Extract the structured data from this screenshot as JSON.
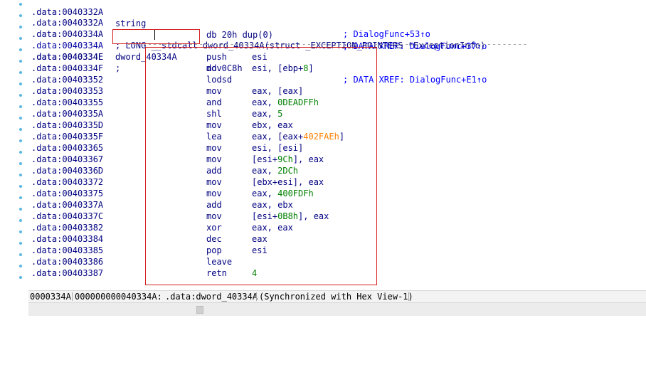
{
  "colors": {
    "address": "#000080",
    "comment": "#0000ff",
    "number": "#008000",
    "hex_constant": "#ff8000",
    "highlight_box": "#d42020",
    "gutter_dot": "#59b7e6"
  },
  "top_lines": [
    {
      "addr": ".data:0040332A",
      "text": "string",
      "text2": "db 20h dup(0)",
      "comment": "; DATA XREF: DialogFunc+37↑o"
    },
    {
      "addr": ".data:0040332A",
      "text": "",
      "text2": "",
      "comment": "; DialogFunc+53↑o"
    },
    {
      "addr": ".data:0040334A",
      "text": "; LONG __stdcall dword_40334A(struct _EXCEPTION_POINTERS *ExceptionInfo)",
      "text2": "",
      "comment": ""
    },
    {
      "addr": ".data:0040334A",
      "text": "dword_40334A",
      "text2": "dd 0C8h",
      "comment": "; DATA XREF: DialogFunc+E1↑o"
    },
    {
      "addr": ".data:0040334E",
      "text": ";",
      "text2": "",
      "comment": ""
    }
  ],
  "code": [
    {
      "addr": ".data:0040334E",
      "mn": "push",
      "ops": [
        {
          "t": "esi",
          "k": "r"
        }
      ]
    },
    {
      "addr": ".data:0040334F",
      "mn": "mov",
      "ops": [
        {
          "t": "esi, [ebp+",
          "k": "r"
        },
        {
          "t": "8",
          "k": "n"
        },
        {
          "t": "]",
          "k": "r"
        }
      ]
    },
    {
      "addr": ".data:00403352",
      "mn": "lodsd",
      "ops": []
    },
    {
      "addr": ".data:00403353",
      "mn": "mov",
      "ops": [
        {
          "t": "eax, [eax]",
          "k": "r"
        }
      ]
    },
    {
      "addr": ".data:00403355",
      "mn": "and",
      "ops": [
        {
          "t": "eax, ",
          "k": "r"
        },
        {
          "t": "0DEADFFh",
          "k": "n"
        }
      ]
    },
    {
      "addr": ".data:0040335A",
      "mn": "shl",
      "ops": [
        {
          "t": "eax, ",
          "k": "r"
        },
        {
          "t": "5",
          "k": "n"
        }
      ]
    },
    {
      "addr": ".data:0040335D",
      "mn": "mov",
      "ops": [
        {
          "t": "ebx, eax",
          "k": "r"
        }
      ]
    },
    {
      "addr": ".data:0040335F",
      "mn": "lea",
      "ops": [
        {
          "t": "eax, [eax+",
          "k": "r"
        },
        {
          "t": "402FAEh",
          "k": "h"
        },
        {
          "t": "]",
          "k": "r"
        }
      ]
    },
    {
      "addr": ".data:00403365",
      "mn": "mov",
      "ops": [
        {
          "t": "esi, [esi]",
          "k": "r"
        }
      ]
    },
    {
      "addr": ".data:00403367",
      "mn": "mov",
      "ops": [
        {
          "t": "[esi+",
          "k": "r"
        },
        {
          "t": "9Ch",
          "k": "n"
        },
        {
          "t": "], eax",
          "k": "r"
        }
      ]
    },
    {
      "addr": ".data:0040336D",
      "mn": "add",
      "ops": [
        {
          "t": "eax, ",
          "k": "r"
        },
        {
          "t": "2DCh",
          "k": "n"
        }
      ]
    },
    {
      "addr": ".data:00403372",
      "mn": "mov",
      "ops": [
        {
          "t": "[ebx+esi], eax",
          "k": "r"
        }
      ]
    },
    {
      "addr": ".data:00403375",
      "mn": "mov",
      "ops": [
        {
          "t": "eax, ",
          "k": "r"
        },
        {
          "t": "400FDFh",
          "k": "n"
        }
      ]
    },
    {
      "addr": ".data:0040337A",
      "mn": "add",
      "ops": [
        {
          "t": "eax, ebx",
          "k": "r"
        }
      ]
    },
    {
      "addr": ".data:0040337C",
      "mn": "mov",
      "ops": [
        {
          "t": "[esi+",
          "k": "r"
        },
        {
          "t": "0B8h",
          "k": "n"
        },
        {
          "t": "], eax",
          "k": "r"
        }
      ]
    },
    {
      "addr": ".data:00403382",
      "mn": "xor",
      "ops": [
        {
          "t": "eax, eax",
          "k": "r"
        }
      ]
    },
    {
      "addr": ".data:00403384",
      "mn": "dec",
      "ops": [
        {
          "t": "eax",
          "k": "r"
        }
      ]
    },
    {
      "addr": ".data:00403385",
      "mn": "pop",
      "ops": [
        {
          "t": "esi",
          "k": "r"
        }
      ]
    },
    {
      "addr": ".data:00403386",
      "mn": "leave",
      "ops": []
    },
    {
      "addr": ".data:00403387",
      "mn": "retn",
      "ops": [
        {
          "t": "4",
          "k": "n"
        }
      ]
    }
  ],
  "status": {
    "file_offset": "0000334A",
    "address": "000000000040334A:",
    "location": ".data:dword_40334A",
    "sync": "(Synchronized with Hex View-1)"
  }
}
